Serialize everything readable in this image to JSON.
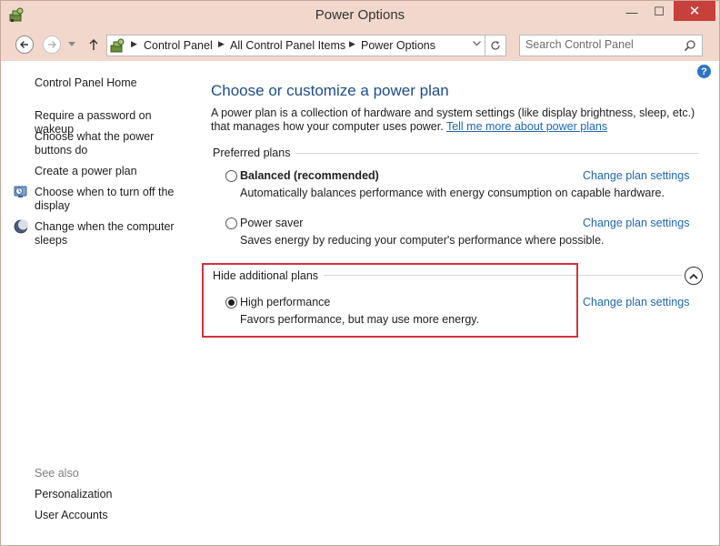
{
  "window": {
    "title": "Power Options",
    "minimize": "—",
    "maximize": "☐",
    "close": "✕"
  },
  "address": {
    "crumbs": [
      "Control Panel",
      "All Control Panel Items",
      "Power Options"
    ],
    "search_placeholder": "Search Control Panel"
  },
  "help": {
    "label": "?"
  },
  "sidebar": {
    "home": "Control Panel Home",
    "items": [
      "Require a password on wakeup",
      "Choose what the power buttons do",
      "Create a power plan",
      "Choose when to turn off the display",
      "Change when the computer sleeps"
    ],
    "see_also": "See also",
    "see_also_items": [
      "Personalization",
      "User Accounts"
    ]
  },
  "main": {
    "title": "Choose or customize a power plan",
    "description": "A power plan is a collection of hardware and system settings (like display brightness, sleep, etc.) that manages how your computer uses power.",
    "tell_more": "Tell me more about power plans",
    "preferred_label": "Preferred plans",
    "additional_label": "Hide additional plans",
    "plans": [
      {
        "name": "Balanced (recommended)",
        "description": "Automatically balances performance with energy consumption on capable hardware.",
        "link": "Change plan settings",
        "selected": false
      },
      {
        "name": "Power saver",
        "description": "Saves energy by reducing your computer's performance where possible.",
        "link": "Change plan settings",
        "selected": false
      },
      {
        "name": "High performance",
        "description": "Favors performance, but may use more energy.",
        "link": "Change plan settings",
        "selected": true
      }
    ]
  },
  "colors": {
    "title_bar": "#f2d8cc",
    "close_button": "#c7403a",
    "heading": "#1e4d8b",
    "link": "#1f67b4",
    "highlight_border": "#d4323c"
  }
}
